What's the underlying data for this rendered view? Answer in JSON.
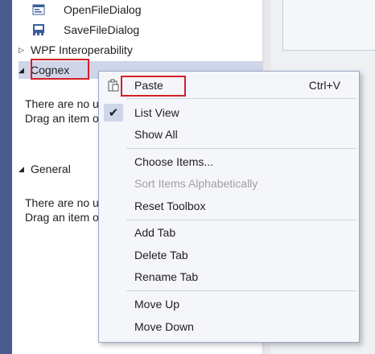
{
  "toolbox": {
    "items": [
      {
        "label": "OpenFileDialog",
        "icon": "open-file-dialog-icon"
      },
      {
        "label": "SaveFileDialog",
        "icon": "save-file-dialog-icon"
      }
    ],
    "groups": [
      {
        "label": "WPF Interoperability",
        "expanded": false
      },
      {
        "label": "Cognex",
        "expanded": true
      },
      {
        "label": "General",
        "expanded": true
      }
    ],
    "empty_message_line1": "There are no u",
    "empty_message_line2": "Drag an item o"
  },
  "context_menu": {
    "paste": {
      "label": "Paste",
      "shortcut": "Ctrl+V",
      "icon": "paste-icon"
    },
    "list_view": {
      "label": "List View",
      "checked": true
    },
    "show_all": {
      "label": "Show All"
    },
    "choose_items": {
      "label": "Choose Items..."
    },
    "sort_items": {
      "label": "Sort Items Alphabetically",
      "disabled": true
    },
    "reset_toolbox": {
      "label": "Reset Toolbox"
    },
    "add_tab": {
      "label": "Add Tab"
    },
    "delete_tab": {
      "label": "Delete Tab"
    },
    "rename_tab": {
      "label": "Rename Tab"
    },
    "move_up": {
      "label": "Move Up"
    },
    "move_down": {
      "label": "Move Down"
    }
  },
  "colors": {
    "accent_strip": "#4c5b8f",
    "selection": "#cfd6ea",
    "highlight_box": "#d31f26"
  }
}
